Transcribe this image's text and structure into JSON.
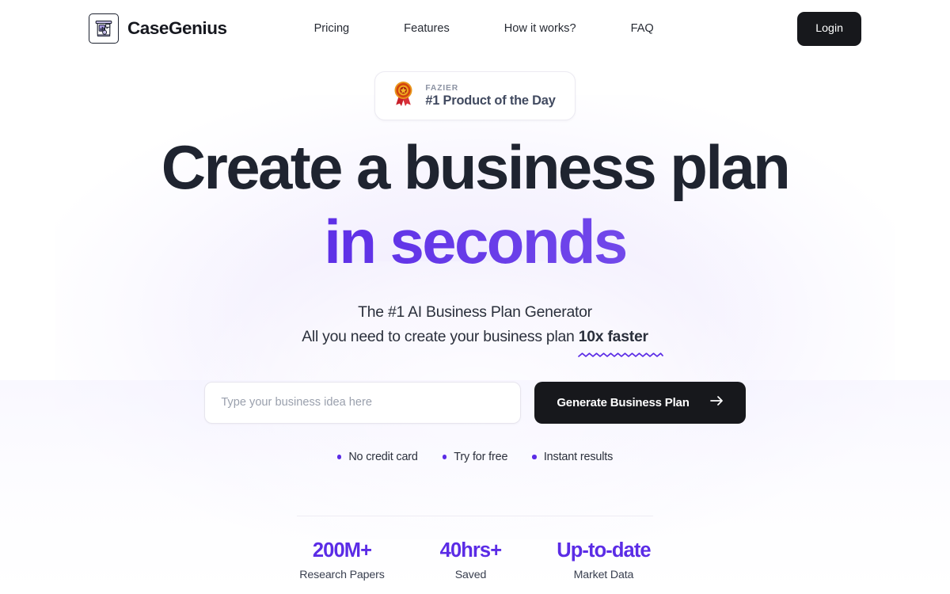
{
  "header": {
    "brand": {
      "name": "CaseGenius",
      "logo_icon": "presentation-board-icon"
    },
    "nav": [
      {
        "label": "Pricing"
      },
      {
        "label": "Features"
      },
      {
        "label": "How it works?"
      },
      {
        "label": "FAQ"
      }
    ],
    "login_label": "Login"
  },
  "badge": {
    "icon": "award-ribbon-icon",
    "kicker": "FAZIER",
    "title": "#1 Product of the Day"
  },
  "hero": {
    "headline_line1": "Create a business plan",
    "headline_line2": "in seconds",
    "sub_line1": "The #1 AI Business Plan Generator",
    "sub_line2_prefix": "All you need to create your business plan ",
    "sub_line2_highlight": "10x faster"
  },
  "form": {
    "input_value": "",
    "input_placeholder": "Type your business idea here",
    "cta_label": "Generate Business Plan",
    "cta_icon": "arrow-right-icon"
  },
  "perks": [
    {
      "label": "No credit card"
    },
    {
      "label": "Try for free"
    },
    {
      "label": "Instant results"
    }
  ],
  "stats": [
    {
      "value": "200M+",
      "label": "Research Papers"
    },
    {
      "value": "40hrs+",
      "label": "Saved"
    },
    {
      "value": "Up-to-date",
      "label": "Market Data"
    }
  ],
  "colors": {
    "accent_purple": "#5b2ce6",
    "accent_purple_light": "#8b6bf0",
    "ink": "#1f2430",
    "button_dark": "#17181c",
    "badge_title": "#414a60",
    "muted": "#8c93a3"
  }
}
